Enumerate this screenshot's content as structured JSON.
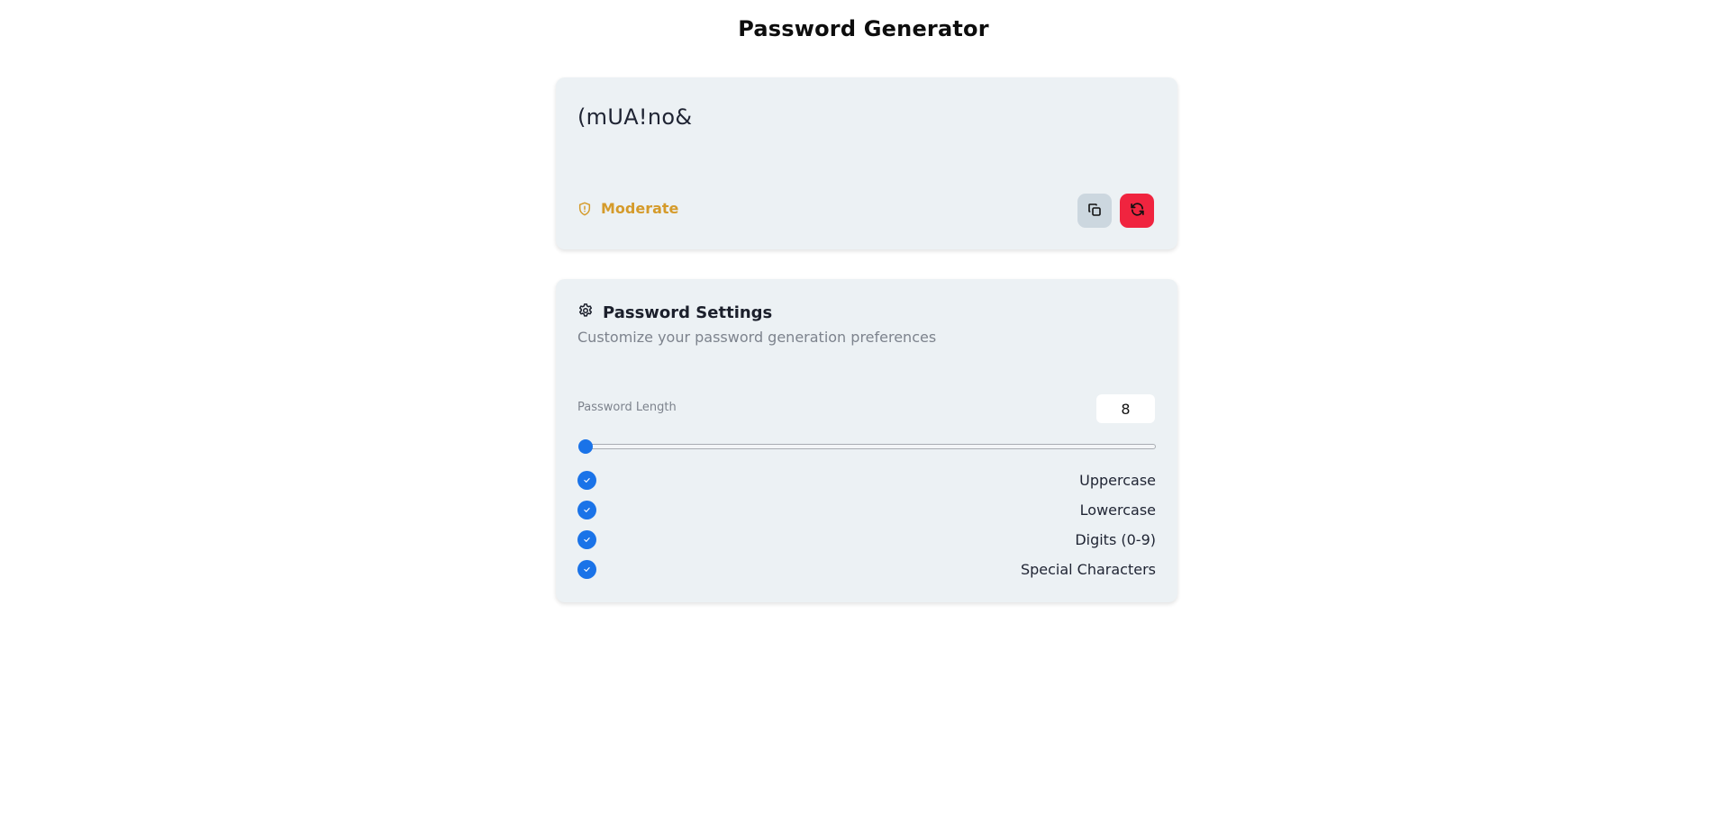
{
  "app": {
    "title": "Password Generator"
  },
  "output": {
    "password": "(mUA!no&",
    "strength_label": "Moderate",
    "strength_color": "#d59b2b",
    "copy_icon": "copy-icon",
    "refresh_icon": "refresh-icon"
  },
  "settings": {
    "title": "Password Settings",
    "subtitle": "Customize your password generation preferences",
    "length_label": "Password Length",
    "length_value": "8",
    "slider_fraction": 0,
    "options": [
      {
        "label": "Uppercase",
        "checked": true
      },
      {
        "label": "Lowercase",
        "checked": true
      },
      {
        "label": "Digits (0-9)",
        "checked": true
      },
      {
        "label": "Special Characters",
        "checked": true
      }
    ]
  },
  "colors": {
    "accent": "#1a73e8",
    "danger": "#f0243f",
    "card_bg": "#ecf1f4"
  }
}
